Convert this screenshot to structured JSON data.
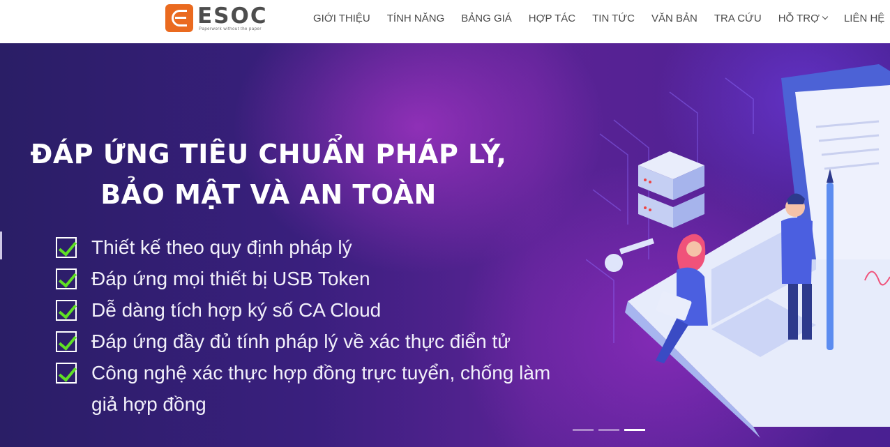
{
  "header": {
    "logo": {
      "word": "ESOC",
      "tagline": "Paperwork without the paper"
    },
    "nav": [
      {
        "label": "GIỚI THIỆU"
      },
      {
        "label": "TÍNH NĂNG"
      },
      {
        "label": "BẢNG GIÁ"
      },
      {
        "label": "HỢP TÁC"
      },
      {
        "label": "TIN TỨC"
      },
      {
        "label": "VĂN BẢN"
      },
      {
        "label": "TRA CỨU"
      },
      {
        "label": "HỖ TRỢ",
        "has_dropdown": true
      },
      {
        "label": "LIÊN HỆ"
      }
    ]
  },
  "banner": {
    "headline_line1": "ĐÁP ỨNG TIÊU CHUẨN PHÁP LÝ,",
    "headline_line2": "BẢO MẬT VÀ AN TOÀN",
    "features": [
      "Thiết kế theo quy định pháp lý",
      "Đáp ứng mọi thiết bị USB Token",
      "Dễ dàng tích hợp ký số CA Cloud",
      "Đáp ứng đầy đủ tính pháp lý về xác thực điển tử",
      "Công nghệ xác thực hợp đồng trực tuyển, chống làm giả hợp đồng"
    ],
    "slides": {
      "count": 3,
      "active_index": 2
    }
  },
  "colors": {
    "brand_orange": "#ea6a1f",
    "nav_text": "#4a4a4a",
    "check_green": "#5fe024",
    "banner_purple": "#3a1f7e"
  }
}
